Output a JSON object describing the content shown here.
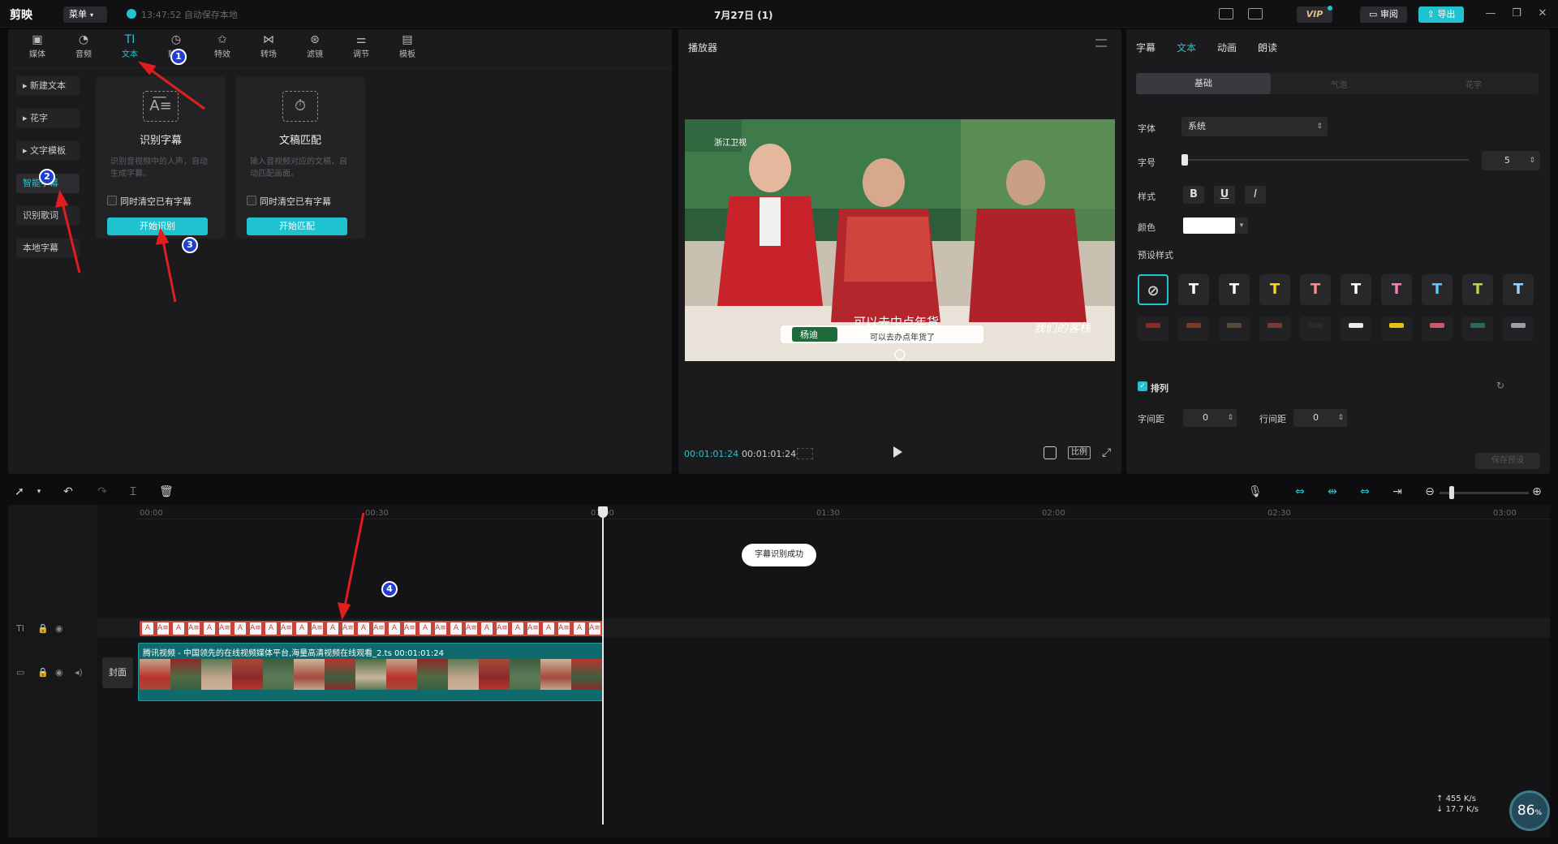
{
  "titlebar": {
    "app_name": "剪映",
    "menu_label": "菜单",
    "save_status": "13:47:52 自动保存本地",
    "project_title": "7月27日 (1)",
    "vip_label": "VIP",
    "review_label": "审阅",
    "export_label": "导出"
  },
  "tool_tabs": [
    {
      "label": "媒体",
      "icon": "media-icon"
    },
    {
      "label": "音频",
      "icon": "audio-icon"
    },
    {
      "label": "文本",
      "icon": "text-icon"
    },
    {
      "label": "贴纸",
      "icon": "sticker-icon"
    },
    {
      "label": "特效",
      "icon": "effects-icon"
    },
    {
      "label": "转场",
      "icon": "transition-icon"
    },
    {
      "label": "滤镜",
      "icon": "filter-icon"
    },
    {
      "label": "调节",
      "icon": "adjust-icon"
    },
    {
      "label": "模板",
      "icon": "template-icon"
    }
  ],
  "text_categories": [
    "新建文本",
    "花字",
    "文字模板",
    "智能字幕",
    "识别歌词",
    "本地字幕"
  ],
  "cards": [
    {
      "title": "识别字幕",
      "desc": "识别音视频中的人声，自动生成字幕。",
      "checkbox": "同时清空已有字幕",
      "button": "开始识别"
    },
    {
      "title": "文稿匹配",
      "desc": "输入音视频对应的文稿，自动匹配画面。",
      "checkbox": "同时清空已有字幕",
      "button": "开始匹配"
    }
  ],
  "player": {
    "title": "播放器",
    "current_time": "00:01:01:24",
    "total_time": "00:01:01:24",
    "ratio_label": "比例",
    "caption_line1": "可以去中点年货",
    "caption_line2": "可以去办点年货了",
    "channel": "浙江卫视",
    "name_tag": "杨迪",
    "show_logo": "我们的客栈"
  },
  "right_panel": {
    "tabs": [
      "字幕",
      "文本",
      "动画",
      "朗读"
    ],
    "segments": [
      "基础",
      "气泡",
      "花字"
    ],
    "font_label": "字体",
    "font_value": "系统",
    "size_label": "字号",
    "size_value": "5",
    "style_label": "样式",
    "style_buttons": [
      "B",
      "U",
      "I"
    ],
    "color_label": "颜色",
    "color_value": "#ffffff",
    "preset_label": "预设样式",
    "arrange_label": "排列",
    "letter_spacing_label": "字间距",
    "letter_spacing_value": "0",
    "line_spacing_label": "行间距",
    "line_spacing_value": "0",
    "save_preset_label": "保存预设"
  },
  "presets": [
    {
      "glyph": "⃠",
      "color": "#cfcfcf"
    },
    {
      "glyph": "T",
      "color": "#ffffff"
    },
    {
      "glyph": "T",
      "color": "#ffffff"
    },
    {
      "glyph": "T",
      "color": "#f2d21a"
    },
    {
      "glyph": "T",
      "color": "#ff8a8a"
    },
    {
      "glyph": "T",
      "color": "#ffffff"
    },
    {
      "glyph": "T",
      "color": "#ff7ab4"
    },
    {
      "glyph": "T",
      "color": "#5bc8ff"
    },
    {
      "glyph": "T",
      "color": "#b5d640"
    },
    {
      "glyph": "T",
      "color": "#9ad0ff"
    }
  ],
  "presets_row2_colors": [
    "#8a2b2b",
    "#7a3b2b",
    "#5a4a3a",
    "#7a3a3a",
    "#2a2a2a",
    "#eaeaea",
    "#e4c21a",
    "#c85a6a",
    "#2a6a5a",
    "#9aa0a8"
  ],
  "timeline": {
    "ticks": [
      "00:00",
      "00:30",
      "01:00",
      "01:30",
      "02:00",
      "02:30",
      "03:00"
    ],
    "toast": "字幕识别成功",
    "video_clip_label": "腾讯视频 - 中国领先的在线视频媒体平台,海量高清视频在线观看_2.ts   00:01:01:24",
    "cover_label": "封面",
    "text_track_icon": "TI"
  },
  "annotations": [
    "1",
    "2",
    "3",
    "4"
  ],
  "system": {
    "net_up": "455",
    "net_down": "17.7",
    "gauge": "86"
  },
  "colors": {
    "accent": "#22c5cf",
    "panel": "#1b1b1e",
    "text_clip": "#c7463c",
    "video_clip": "#0f6a6e"
  }
}
